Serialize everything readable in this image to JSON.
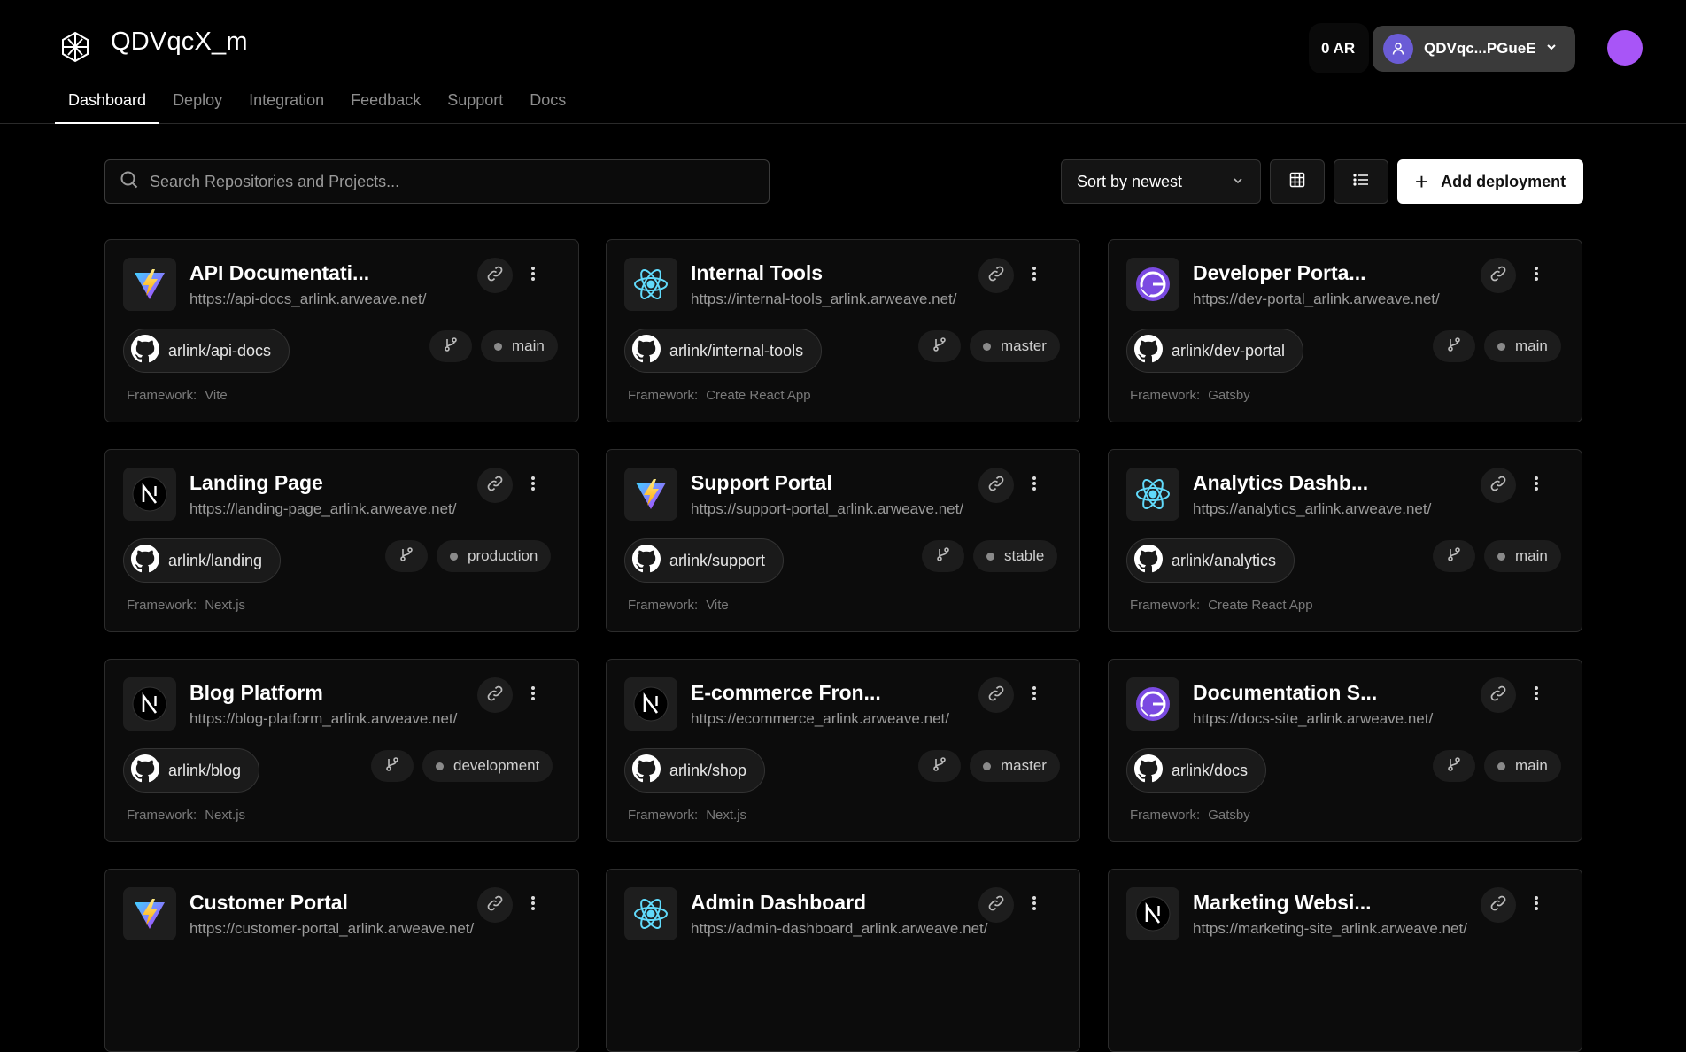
{
  "header": {
    "app_title": "QDVqcX_m",
    "balance": "0 AR",
    "wallet_address": "QDVqc...PGueE",
    "nav": [
      "Dashboard",
      "Deploy",
      "Integration",
      "Feedback",
      "Support",
      "Docs"
    ],
    "active_tab": "Dashboard"
  },
  "toolbar": {
    "search_placeholder": "Search Repositories and Projects...",
    "sort_label": "Sort by newest",
    "add_label": "Add deployment"
  },
  "framework_label": "Framework:",
  "colors": {
    "profile_avatar": "#a855f7",
    "wallet_avatar": "#6b5cd6",
    "vite": "#ffd028",
    "react": "#61dafb",
    "gatsby": "#7b4ae2"
  },
  "projects": [
    {
      "name": "API Documentati...",
      "url": "https://api-docs_arlink.arweave.net/",
      "repo": "arlink/api-docs",
      "branch": "main",
      "framework": "Vite",
      "icon": "vite-icon"
    },
    {
      "name": "Internal Tools",
      "url": "https://internal-tools_arlink.arweave.net/",
      "repo": "arlink/internal-tools",
      "branch": "master",
      "framework": "Create React App",
      "icon": "react-icon"
    },
    {
      "name": "Developer Porta...",
      "url": "https://dev-portal_arlink.arweave.net/",
      "repo": "arlink/dev-portal",
      "branch": "main",
      "framework": "Gatsby",
      "icon": "gatsby-icon"
    },
    {
      "name": "Landing Page",
      "url": "https://landing-page_arlink.arweave.net/",
      "repo": "arlink/landing",
      "branch": "production",
      "framework": "Next.js",
      "icon": "nextjs-icon"
    },
    {
      "name": "Support Portal",
      "url": "https://support-portal_arlink.arweave.net/",
      "repo": "arlink/support",
      "branch": "stable",
      "framework": "Vite",
      "icon": "vite-icon"
    },
    {
      "name": "Analytics Dashb...",
      "url": "https://analytics_arlink.arweave.net/",
      "repo": "arlink/analytics",
      "branch": "main",
      "framework": "Create React App",
      "icon": "react-icon"
    },
    {
      "name": "Blog Platform",
      "url": "https://blog-platform_arlink.arweave.net/",
      "repo": "arlink/blog",
      "branch": "development",
      "framework": "Next.js",
      "icon": "nextjs-icon"
    },
    {
      "name": "E-commerce Fron...",
      "url": "https://ecommerce_arlink.arweave.net/",
      "repo": "arlink/shop",
      "branch": "master",
      "framework": "Next.js",
      "icon": "nextjs-icon"
    },
    {
      "name": "Documentation S...",
      "url": "https://docs-site_arlink.arweave.net/",
      "repo": "arlink/docs",
      "branch": "main",
      "framework": "Gatsby",
      "icon": "gatsby-icon"
    },
    {
      "name": "Customer Portal",
      "url": "https://customer-portal_arlink.arweave.net/",
      "icon": "vite-icon"
    },
    {
      "name": "Admin Dashboard",
      "url": "https://admin-dashboard_arlink.arweave.net/",
      "icon": "react-icon"
    },
    {
      "name": "Marketing Websi...",
      "url": "https://marketing-site_arlink.arweave.net/",
      "icon": "nextjs-icon"
    }
  ]
}
